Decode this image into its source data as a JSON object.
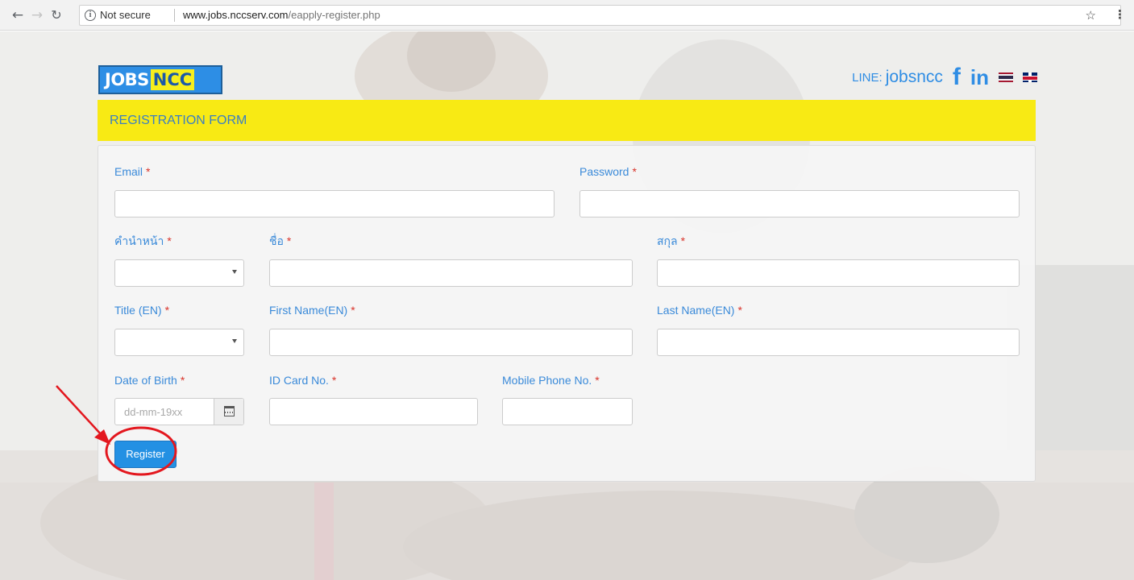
{
  "browser": {
    "security_label": "Not secure",
    "url_host": "www.jobs.nccserv.com",
    "url_path": "/eapply-register.php"
  },
  "header": {
    "logo_part1": "JOBS",
    "logo_part2": "NCC",
    "line_label": "LINE:",
    "line_id": "jobsncc",
    "facebook_glyph": "f",
    "linkedin_glyph": "in"
  },
  "form": {
    "title": "REGISTRATION FORM",
    "required_mark": "*",
    "fields": {
      "email": {
        "label": "Email",
        "value": ""
      },
      "password": {
        "label": "Password",
        "value": ""
      },
      "title_th": {
        "label": "คำนำหน้า",
        "selected": ""
      },
      "first_name_th": {
        "label": "ชื่อ",
        "value": ""
      },
      "last_name_th": {
        "label": "สกุล",
        "value": ""
      },
      "title_en": {
        "label": "Title (EN)",
        "selected": ""
      },
      "first_name_en": {
        "label": "First Name(EN)",
        "value": ""
      },
      "last_name_en": {
        "label": "Last Name(EN)",
        "value": ""
      },
      "dob": {
        "label": "Date of Birth",
        "placeholder": "dd-mm-19xx",
        "value": ""
      },
      "id_card": {
        "label": "ID Card No.",
        "value": ""
      },
      "mobile": {
        "label": "Mobile Phone No.",
        "value": ""
      }
    },
    "submit_label": "Register"
  },
  "icons": [
    "back-arrow-icon",
    "forward-arrow-icon",
    "reload-icon",
    "info-icon",
    "star-icon",
    "kebab-menu-icon",
    "facebook-icon",
    "linkedin-icon",
    "thai-flag-icon",
    "uk-flag-icon",
    "calendar-icon"
  ],
  "colors": {
    "accent_blue": "#2f8de4",
    "header_yellow": "#f8ea14",
    "required_red": "#d9342b",
    "button_blue": "#2390e3",
    "annotation_red": "#e3171e"
  }
}
